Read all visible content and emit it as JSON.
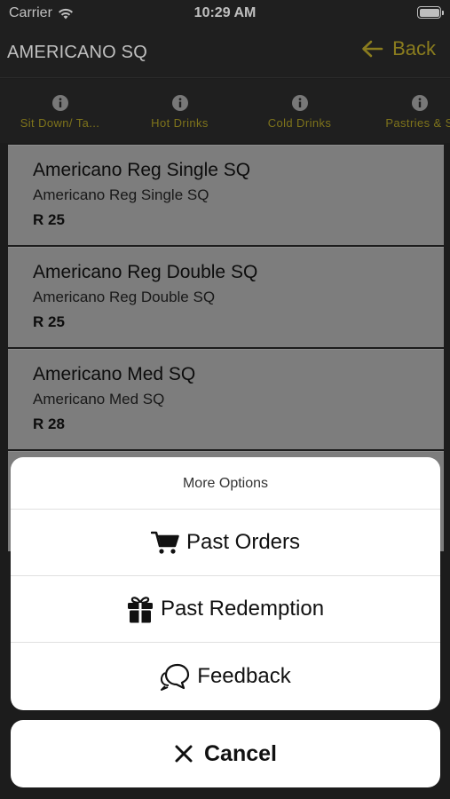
{
  "status_bar": {
    "carrier": "Carrier",
    "time": "10:29 AM"
  },
  "nav": {
    "title": "AMERICANO SQ",
    "back_label": "Back"
  },
  "tabs": [
    {
      "label": "Sit Down/ Ta..."
    },
    {
      "label": "Hot Drinks"
    },
    {
      "label": "Cold Drinks"
    },
    {
      "label": "Pastries & S"
    }
  ],
  "products": [
    {
      "name": "Americano Reg Single SQ",
      "description": "Americano Reg Single SQ",
      "price": "R 25"
    },
    {
      "name": "Americano Reg Double SQ",
      "description": "Americano Reg Double SQ",
      "price": "R 25"
    },
    {
      "name": "Americano Med SQ",
      "description": "Americano Med SQ",
      "price": "R 28"
    },
    {
      "name": "",
      "description": "",
      "price": ""
    }
  ],
  "sheet": {
    "title": "More Options",
    "options": [
      {
        "label": "Past Orders",
        "icon": "cart-icon"
      },
      {
        "label": "Past Redemption",
        "icon": "gift-icon"
      },
      {
        "label": "Feedback",
        "icon": "chat-bubbles-icon"
      }
    ],
    "cancel_label": "Cancel"
  },
  "colors": {
    "accent": "#b8a628",
    "tab_text": "#a89a24",
    "product_bg": "#a7a7a7",
    "bar_bg": "#2a2a2a"
  }
}
